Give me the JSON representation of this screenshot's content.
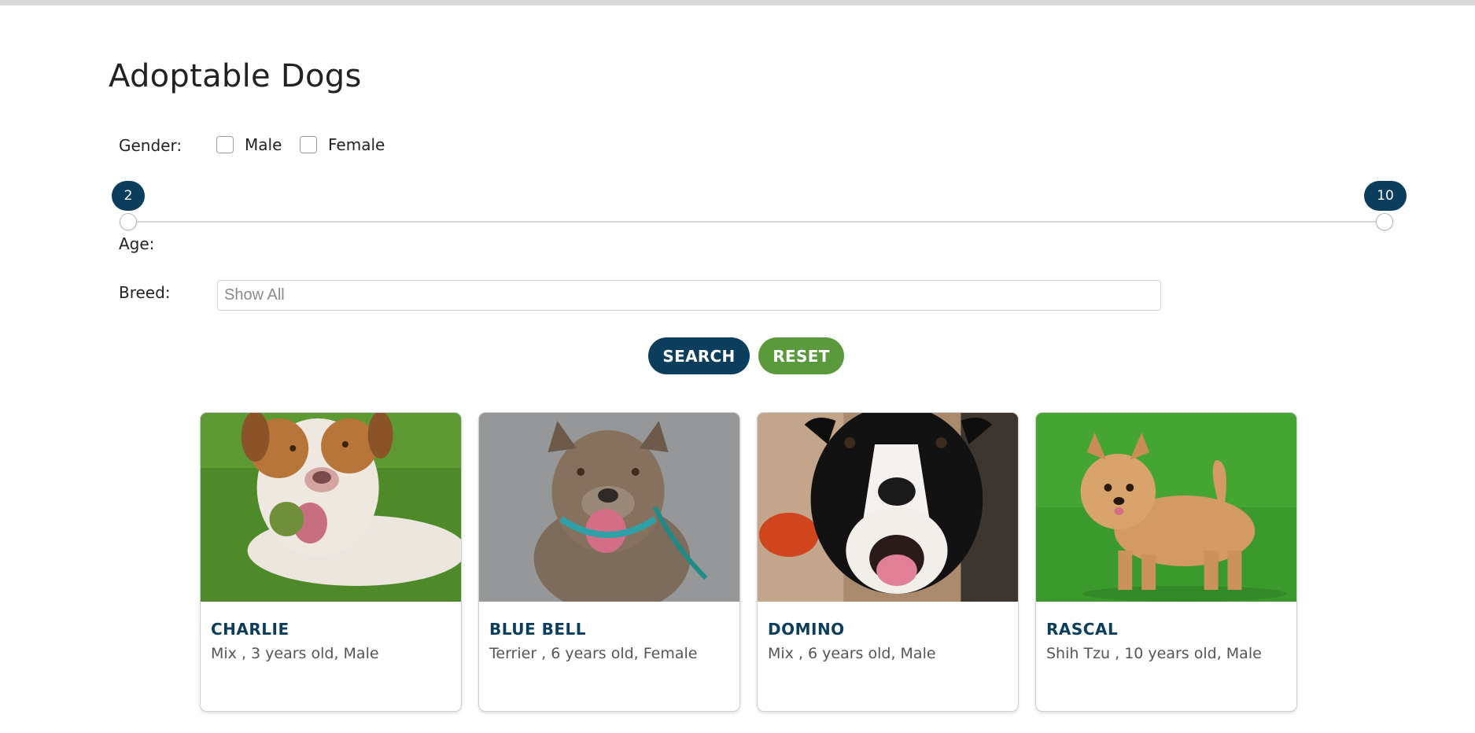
{
  "page": {
    "title": "Adoptable Dogs"
  },
  "filters": {
    "gender_label": "Gender:",
    "gender_options": [
      "Male",
      "Female"
    ],
    "age_label": "Age:",
    "age_min": 2,
    "age_max": 10,
    "breed_label": "Breed:",
    "breed_placeholder": "Show All"
  },
  "buttons": {
    "search": "SEARCH",
    "reset": "RESET"
  },
  "colors": {
    "primary": "#0b3d5c",
    "reset_green": "#5a9a3c"
  },
  "dogs": [
    {
      "name": "CHARLIE",
      "desc": "Mix , 3 years old, Male"
    },
    {
      "name": "BLUE BELL",
      "desc": "Terrier , 6 years old, Female"
    },
    {
      "name": "DOMINO",
      "desc": "Mix , 6 years old, Male"
    },
    {
      "name": "RASCAL",
      "desc": "Shih Tzu , 10 years old, Male"
    }
  ]
}
